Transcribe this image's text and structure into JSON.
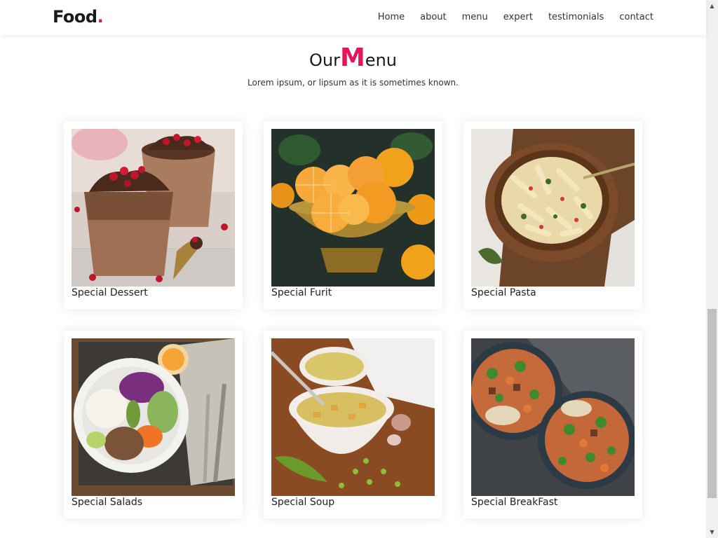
{
  "header": {
    "logo_text": "Food",
    "logo_dot": ".",
    "nav": [
      {
        "label": "Home"
      },
      {
        "label": "about"
      },
      {
        "label": "menu"
      },
      {
        "label": "expert"
      },
      {
        "label": "testimonials"
      },
      {
        "label": "contact"
      }
    ]
  },
  "section": {
    "title_prefix": "Our",
    "title_big": "M",
    "title_suffix": "enu",
    "subtitle": "Lorem ipsum, or lipsum as it is sometimes known."
  },
  "menu_items": [
    {
      "label": "Special Dessert"
    },
    {
      "label": "Special Furit"
    },
    {
      "label": "Special Pasta"
    },
    {
      "label": "Special Salads"
    },
    {
      "label": "Special Soup"
    },
    {
      "label": "Special BreakFast"
    }
  ],
  "colors": {
    "accent": "#e2165b"
  }
}
